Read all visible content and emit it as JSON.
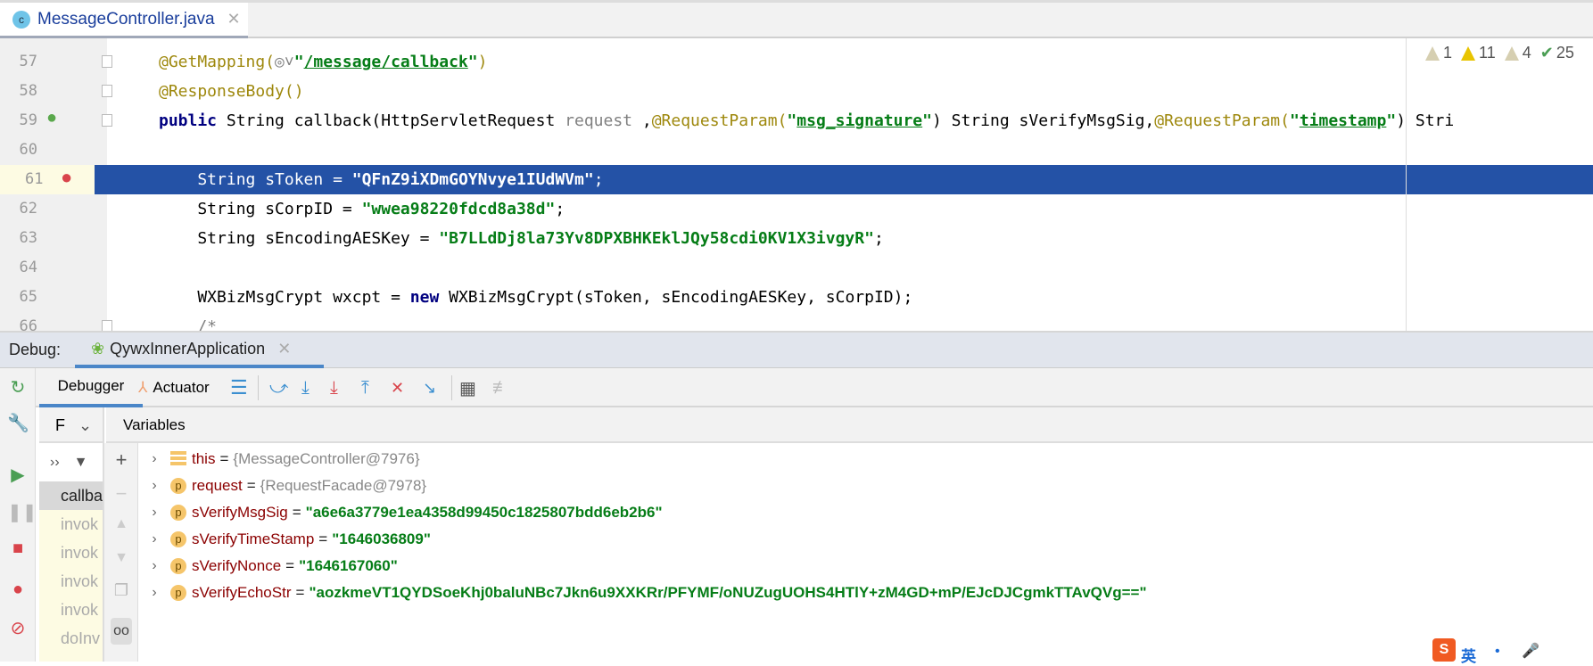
{
  "editor_tab": {
    "icon": "class-icon",
    "icon_letter": "c",
    "name": "MessageController.java"
  },
  "inspections": [
    {
      "icon": "weak-warning-icon",
      "count": "1"
    },
    {
      "icon": "warning-icon",
      "count": "11"
    },
    {
      "icon": "weak-warning-icon",
      "count": "4"
    },
    {
      "icon": "typo-check-icon",
      "count": "25"
    }
  ],
  "code_lines": [
    {
      "n": "57",
      "tokens": [
        [
          "@GetMapping(",
          "ann"
        ],
        [
          "◎˅",
          "par"
        ],
        [
          "\"",
          "str"
        ],
        [
          "/message/callback",
          "strul"
        ],
        [
          "\"",
          "str"
        ],
        [
          ")",
          "ann"
        ]
      ]
    },
    {
      "n": "58",
      "tokens": [
        [
          "@ResponseBody()",
          "ann"
        ]
      ]
    },
    {
      "n": "59",
      "tokens": [
        [
          "public ",
          "kw"
        ],
        [
          "String callback(HttpServletRequest ",
          "pl"
        ],
        [
          "request ",
          "par"
        ],
        [
          ",",
          "pl"
        ],
        [
          "@RequestParam(",
          "ann"
        ],
        [
          "\"",
          "str"
        ],
        [
          "msg_signature",
          "strul"
        ],
        [
          "\"",
          "str"
        ],
        [
          ") String sVerifyMsgSig,",
          "pl"
        ],
        [
          "@RequestParam(",
          "ann"
        ],
        [
          "\"",
          "str"
        ],
        [
          "timestamp",
          "strul"
        ],
        [
          "\"",
          "str"
        ],
        [
          ") Stri",
          "pl"
        ]
      ]
    },
    {
      "n": "60",
      "tokens": []
    },
    {
      "n": "61",
      "tokens": [
        [
          "    String sToken = ",
          "pl"
        ],
        [
          "\"QFnZ9iXDmGOYNvye1IUdWVm\"",
          "str"
        ],
        [
          ";",
          "pl"
        ]
      ],
      "highlighted": true
    },
    {
      "n": "62",
      "tokens": [
        [
          "    String sCorpID = ",
          "pl"
        ],
        [
          "\"wwea98220fdcd8a38d\"",
          "str"
        ],
        [
          ";",
          "pl"
        ]
      ]
    },
    {
      "n": "63",
      "tokens": [
        [
          "    String sEncodingAESKey = ",
          "pl"
        ],
        [
          "\"B7LLdDj8la73Yv8DPXBHKEklJQy58cdi0KV1X3ivgyR\"",
          "str"
        ],
        [
          ";",
          "pl"
        ]
      ]
    },
    {
      "n": "64",
      "tokens": []
    },
    {
      "n": "65",
      "tokens": [
        [
          "    WXBizMsgCrypt wxcpt = ",
          "pl"
        ],
        [
          "new ",
          "kw"
        ],
        [
          "WXBizMsgCrypt(sToken, sEncodingAESKey, sCorpID);",
          "pl"
        ]
      ]
    },
    {
      "n": "66",
      "tokens": [
        [
          "    /*",
          "par"
        ]
      ]
    }
  ],
  "debug": {
    "label": "Debug:",
    "session": "QywxInnerApplication",
    "tabs": {
      "debugger": "Debugger",
      "actuator": "Actuator"
    },
    "frames_header": "F",
    "variables_header": "Variables",
    "frames_filter": "››",
    "frames": [
      "callba",
      "invok",
      "invok",
      "invok",
      "invok",
      "doInv"
    ]
  },
  "variables": [
    {
      "icon": "field-icon",
      "name": "this",
      "value": "{MessageController@7976}",
      "kind": "obj"
    },
    {
      "icon": "parameter-icon",
      "name": "request",
      "value": "{RequestFacade@7978}",
      "kind": "obj"
    },
    {
      "icon": "parameter-icon",
      "name": "sVerifyMsgSig",
      "value": "\"a6e6a3779e1ea4358d99450c1825807bdd6eb2b6\"",
      "kind": "str"
    },
    {
      "icon": "parameter-icon",
      "name": "sVerifyTimeStamp",
      "value": "\"1646036809\"",
      "kind": "str"
    },
    {
      "icon": "parameter-icon",
      "name": "sVerifyNonce",
      "value": "\"1646167060\"",
      "kind": "str"
    },
    {
      "icon": "parameter-icon",
      "name": "sVerifyEchoStr",
      "value": "\"aozkmeVT1QYDSoeKhj0baluNBc7Jkn6u9XXKRr/PFYMF/oNUZugUOHS4HTlY+zM4GD+mP/EJcDJCgmkTTAvQVg==\"",
      "kind": "str"
    }
  ],
  "ime": {
    "mode": "英"
  },
  "colors": {
    "highlight": "#2452a6",
    "string": "#067d17",
    "keyword": "#000080",
    "annotation": "#9e880d",
    "accent": "#4a86c8"
  }
}
